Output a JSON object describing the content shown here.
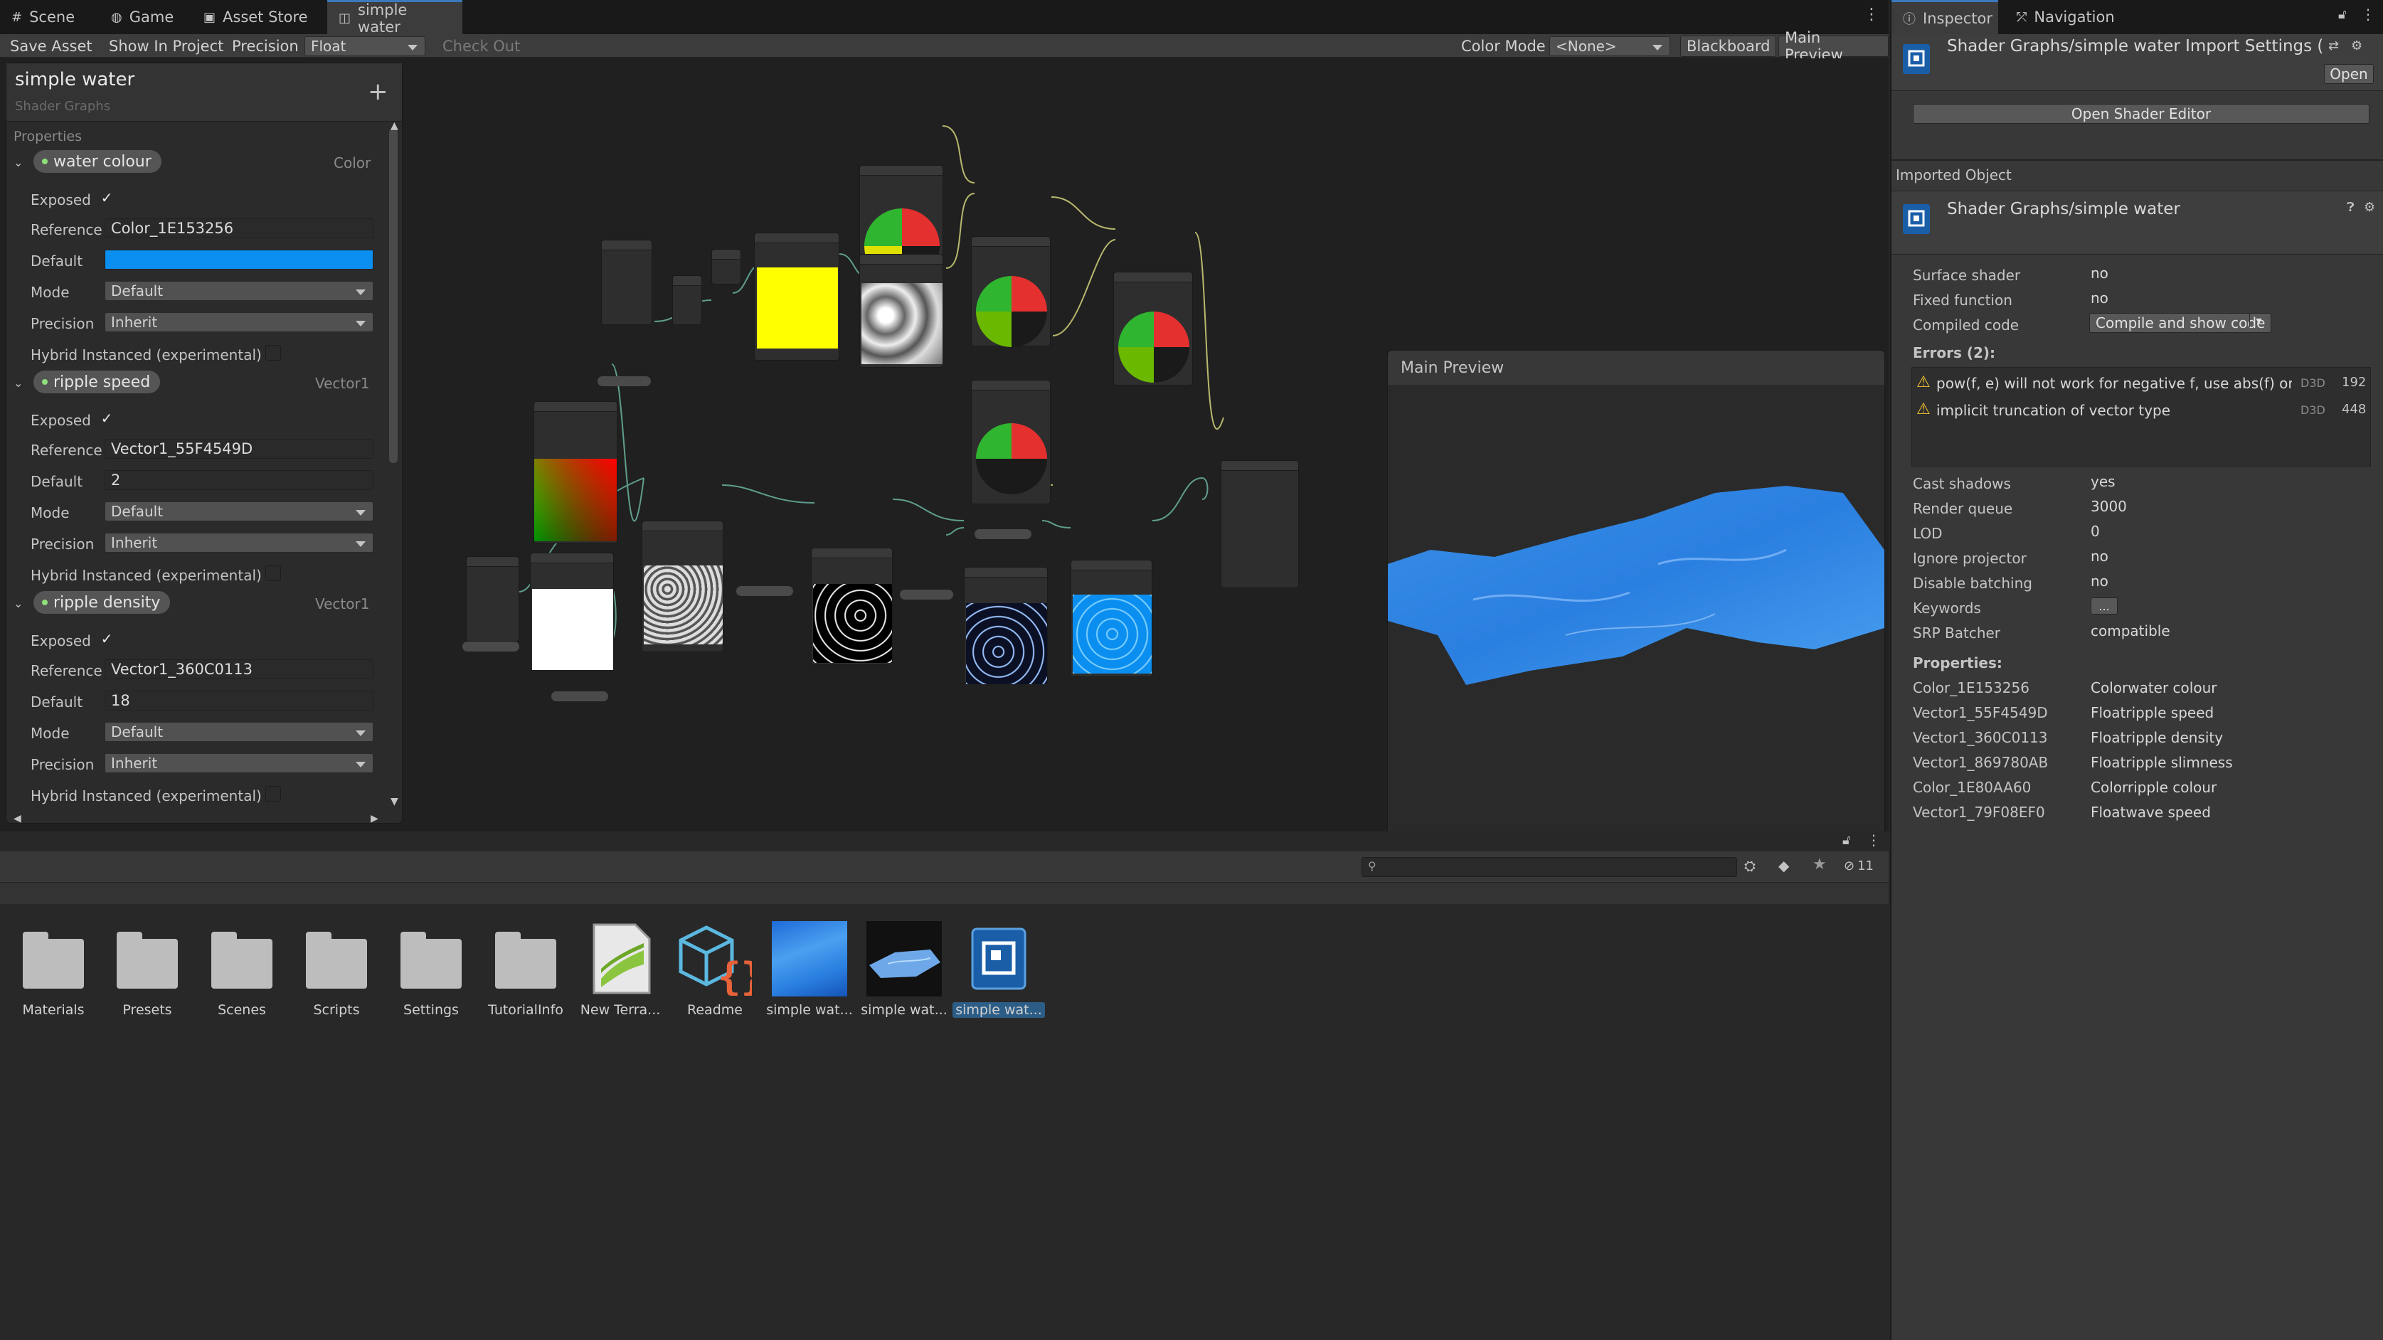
{
  "tabs": [
    {
      "label": "Scene",
      "icon": "grid-icon"
    },
    {
      "label": "Game",
      "icon": "gamepad-icon"
    },
    {
      "label": "Asset Store",
      "icon": "bag-icon"
    },
    {
      "label": "simple water",
      "icon": "shader-graph-icon",
      "active": true
    }
  ],
  "toolbar": {
    "save_asset": "Save Asset",
    "show_in_project": "Show In Project",
    "precision_label": "Precision",
    "precision_value": "Float",
    "check_out": "Check Out",
    "color_mode_label": "Color Mode",
    "color_mode_value": "<None>",
    "blackboard": "Blackboard",
    "main_preview": "Main Preview"
  },
  "blackboard": {
    "title": "simple water",
    "subtitle": "Shader Graphs",
    "section": "Properties",
    "properties": [
      {
        "name": "water colour",
        "type": "Color",
        "exposed": "✓",
        "reference": "Color_1E153256",
        "default": "",
        "default_color": "#0a8ff0",
        "mode": "Default",
        "precision": "Inherit",
        "hybrid": "Hybrid Instanced (experimental)"
      },
      {
        "name": "ripple speed",
        "type": "Vector1",
        "exposed": "✓",
        "reference": "Vector1_55F4549D",
        "default": "2",
        "mode": "Default",
        "precision": "Inherit",
        "hybrid": "Hybrid Instanced (experimental)"
      },
      {
        "name": "ripple density",
        "type": "Vector1",
        "exposed": "✓",
        "reference": "Vector1_360C0113",
        "default": "18",
        "mode": "Default",
        "precision": "Inherit",
        "hybrid": "Hybrid Instanced (experimental)"
      }
    ],
    "labels": {
      "exposed": "Exposed",
      "reference": "Reference",
      "default": "Default",
      "mode": "Mode",
      "precision": "Precision"
    }
  },
  "main_preview": {
    "title": "Main Preview"
  },
  "project": {
    "hidden_count": "11",
    "assets": [
      {
        "label": "Materials",
        "kind": "folder"
      },
      {
        "label": "Presets",
        "kind": "folder"
      },
      {
        "label": "Scenes",
        "kind": "folder"
      },
      {
        "label": "Scripts",
        "kind": "folder"
      },
      {
        "label": "Settings",
        "kind": "folder"
      },
      {
        "label": "TutorialInfo",
        "kind": "folder"
      },
      {
        "label": "New Terra...",
        "kind": "terrain"
      },
      {
        "label": "Readme",
        "kind": "readme"
      },
      {
        "label": "simple wat...",
        "kind": "material"
      },
      {
        "label": "simple wat...",
        "kind": "mesh"
      },
      {
        "label": "simple wat...",
        "kind": "shadergraph",
        "selected": true
      }
    ]
  },
  "inspector": {
    "tabs": [
      {
        "label": "Inspector",
        "icon": "info-icon"
      },
      {
        "label": "Navigation",
        "icon": "navigation-icon"
      }
    ],
    "header_title": "Shader Graphs/simple water Import Settings (Shac",
    "open_button": "Open",
    "open_shader_editor": "Open Shader Editor",
    "imported_object": "Imported Object",
    "object_title": "Shader Graphs/simple water",
    "rows": [
      {
        "label": "Surface shader",
        "value": "no"
      },
      {
        "label": "Fixed function",
        "value": "no"
      }
    ],
    "compiled_code_label": "Compiled code",
    "compile_button": "Compile and show code",
    "errors_label": "Errors (2):",
    "errors": [
      {
        "text": "pow(f, e) will not work for negative f, use abs(f) or con",
        "api": "D3D",
        "line": "192"
      },
      {
        "text": "implicit truncation of vector type",
        "api": "D3D",
        "line": "448"
      }
    ],
    "rows2": [
      {
        "label": "Cast shadows",
        "value": "yes"
      },
      {
        "label": "Render queue",
        "value": "3000"
      },
      {
        "label": "LOD",
        "value": "0"
      },
      {
        "label": "Ignore projector",
        "value": "no"
      },
      {
        "label": "Disable batching",
        "value": "no"
      },
      {
        "label": "Keywords",
        "value": "..."
      },
      {
        "label": "SRP Batcher",
        "value": "compatible"
      }
    ],
    "properties_label": "Properties:",
    "properties": [
      {
        "ref": "Color_1E153256",
        "desc": "Colorwater colour"
      },
      {
        "ref": "Vector1_55F4549D",
        "desc": "Floatripple speed"
      },
      {
        "ref": "Vector1_360C0113",
        "desc": "Floatripple density"
      },
      {
        "ref": "Vector1_869780AB",
        "desc": "Floatripple slimness"
      },
      {
        "ref": "Color_1E80AA60",
        "desc": "Colorripple colour"
      },
      {
        "ref": "Vector1_79F08EF0",
        "desc": "Floatwave speed"
      }
    ]
  }
}
